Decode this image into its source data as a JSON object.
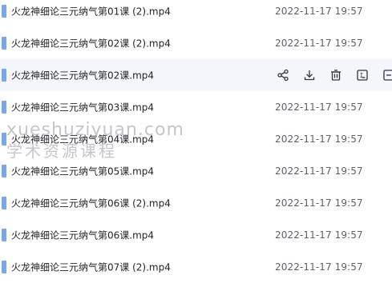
{
  "files": [
    {
      "name": "火龙神细论三元纳气第01课 (2).mp4",
      "date": "2022-11-17 19:57"
    },
    {
      "name": "火龙神细论三元纳气第02课 (2).mp4",
      "date": "2022-11-17 19:57"
    },
    {
      "name": "火龙神细论三元纳气第02课.mp4",
      "date": ""
    },
    {
      "name": "火龙神细论三元纳气第03课.mp4",
      "date": "2022-11-17 19:57"
    },
    {
      "name": "火龙神细论三元纳气第04课.mp4",
      "date": "2022-11-17 19:57"
    },
    {
      "name": "火龙神细论三元纳气第05课.mp4",
      "date": "2022-11-17 19:57"
    },
    {
      "name": "火龙神细论三元纳气第06课 (2).mp4",
      "date": "2022-11-17 19:57"
    },
    {
      "name": "火龙神细论三元纳气第06课.mp4",
      "date": "2022-11-17 19:57"
    },
    {
      "name": "火龙神细论三元纳气第07课 (2).mp4",
      "date": "2022-11-17 19:57"
    }
  ],
  "hover_actions": [
    "share-icon",
    "download-icon",
    "delete-icon",
    "rename-icon",
    "more-icon"
  ],
  "watermark": {
    "line1": "xueshuziyuan.com",
    "line2": "学术资源课程"
  },
  "colors": {
    "hover_row": "#f4f6fb",
    "file_icon": "#7aa7e6",
    "text": "#1f2329",
    "date_text": "#5c6370"
  }
}
